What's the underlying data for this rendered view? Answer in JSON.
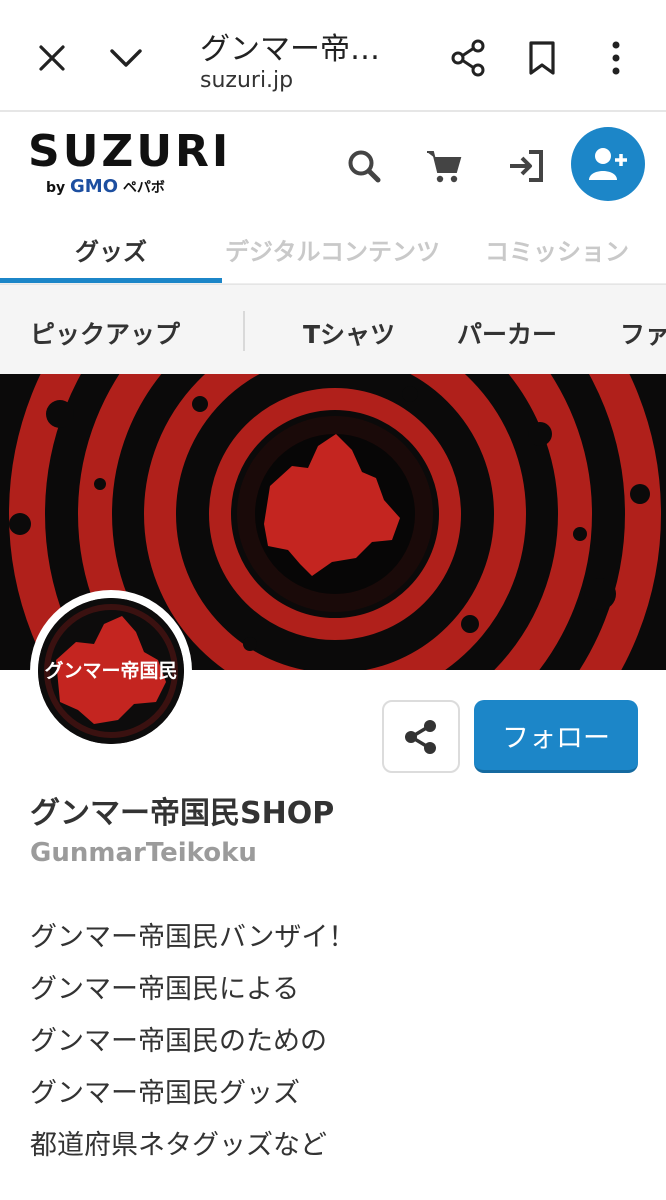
{
  "browser": {
    "title": "グンマー帝…",
    "url": "suzuri.jp",
    "icons": [
      "close-icon",
      "chevron-down-icon",
      "share-icon",
      "bookmark-icon",
      "more-vert-icon"
    ]
  },
  "header": {
    "logo": "SUZURI",
    "logo_by": "by",
    "logo_gmo": "GMO",
    "logo_pepabo": "ペパボ",
    "icons": [
      "search-icon",
      "cart-icon",
      "login-icon",
      "add-user-icon"
    ],
    "accent_color": "#1c86c8"
  },
  "tabs": [
    {
      "label": "グッズ",
      "active": true
    },
    {
      "label": "デジタルコンテンツ",
      "active": false
    },
    {
      "label": "コミッション",
      "active": false
    }
  ],
  "categories": [
    {
      "label": "ピックアップ"
    },
    {
      "label": "Tシャツ"
    },
    {
      "label": "パーカー"
    },
    {
      "label": "ファ"
    }
  ],
  "profile": {
    "avatar_text": "グンマー帝国民",
    "share_icon": "share-icon",
    "follow_label": "フォロー",
    "shop_name": "グンマー帝国民SHOP",
    "shop_id": "GunmarTeikoku",
    "bio": [
      "グンマー帝国民バンザイ！",
      "グンマー帝国民による",
      "グンマー帝国民のための",
      "グンマー帝国民グッズ",
      "都道府県ネタグッズなど"
    ]
  }
}
